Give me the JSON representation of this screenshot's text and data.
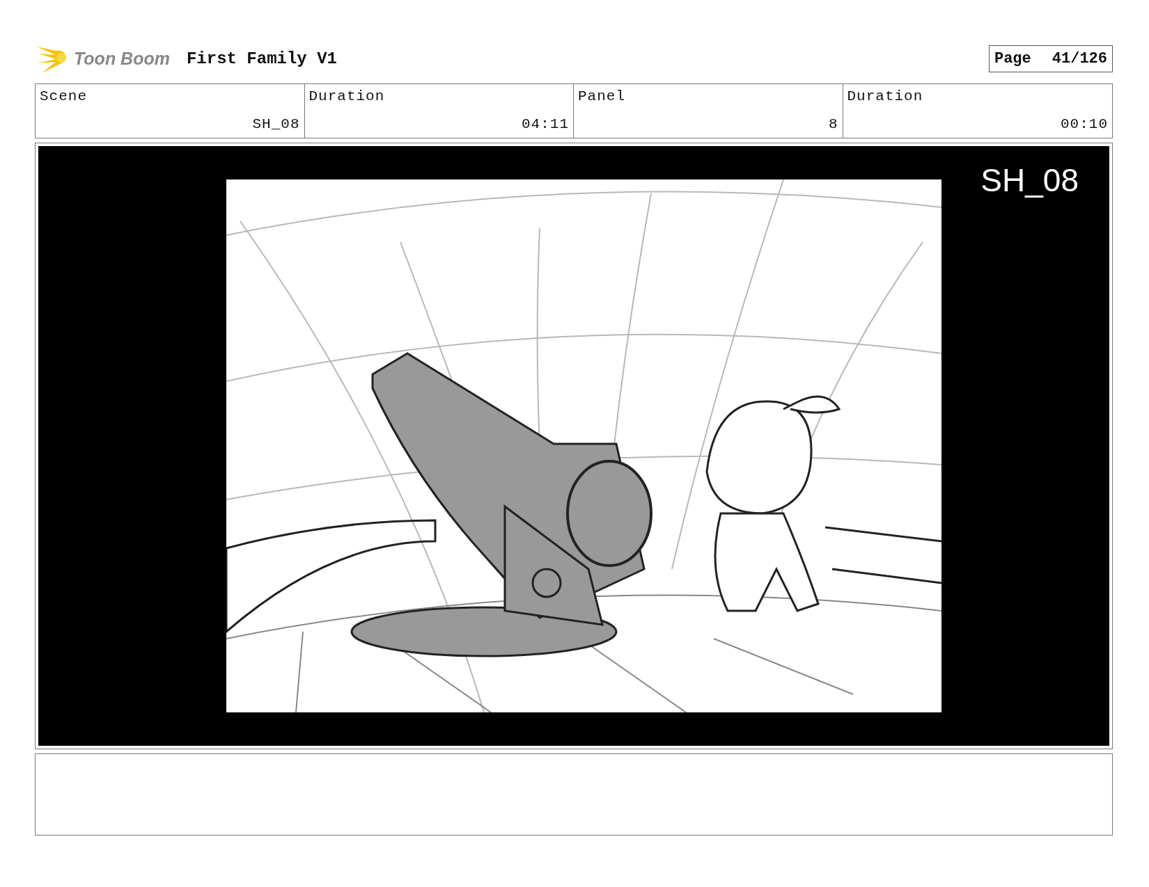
{
  "header": {
    "logo_text": "Toon Boom",
    "title": "First Family V1"
  },
  "page": {
    "label": "Page",
    "number": "41/126"
  },
  "info_table": {
    "columns": [
      "Scene",
      "Duration",
      "Panel",
      "Duration"
    ],
    "rows": [
      [
        "SH_08",
        "04:11",
        "8",
        "00:10"
      ]
    ]
  },
  "panel": {
    "shot_label": "SH_08"
  }
}
